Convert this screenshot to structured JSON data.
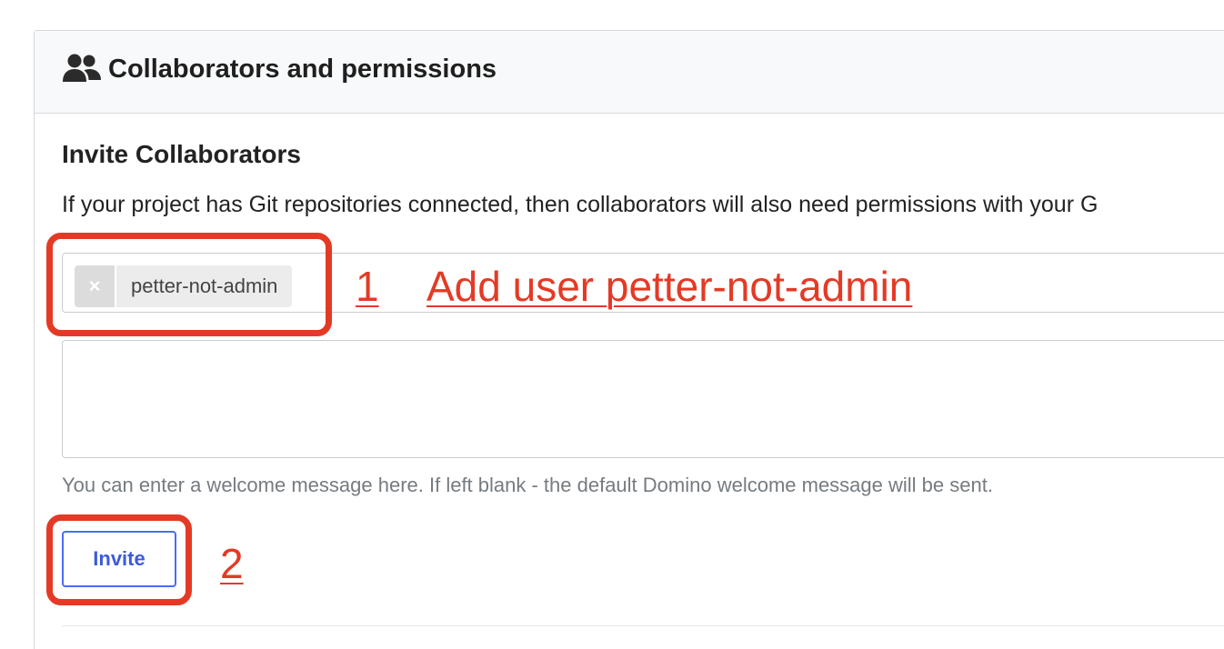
{
  "header": {
    "icon": "people-icon",
    "title": "Collaborators and permissions"
  },
  "invite": {
    "section_title": "Invite Collaborators",
    "info_text": "If your project has Git repositories connected, then collaborators will also need permissions with your G",
    "selected_user": "petter-not-admin",
    "remove_chip_glyph": "×",
    "message_value": "",
    "help_text": "You can enter a welcome message here. If left blank - the default Domino welcome message will be sent.",
    "invite_label": "Invite"
  },
  "annotations": {
    "step1_number": "1",
    "step1_text": "Add user petter-not-admin",
    "step2_number": "2",
    "color": "#e43a25"
  },
  "colors": {
    "accent": "#4a6cf7",
    "header_bg": "#f8f9fa",
    "chip_bg": "#ececec"
  }
}
